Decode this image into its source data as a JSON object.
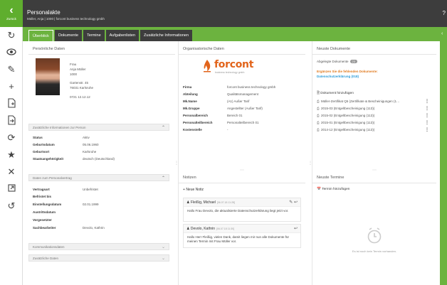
{
  "header": {
    "back_label": "Zurück",
    "title": "Personalakte",
    "subtitle": "Müller, Anja | 1000 | forcont business technology gmbh",
    "help": "?"
  },
  "tabs": [
    {
      "label": "Überblick",
      "active": true
    },
    {
      "label": "Dokumente",
      "active": false
    },
    {
      "label": "Termine",
      "active": false
    },
    {
      "label": "Aufgabenlisten",
      "active": false
    },
    {
      "label": "Zusätzliche Informationen",
      "active": false
    }
  ],
  "personal": {
    "title": "Persönliche Daten",
    "salutation": "Frau",
    "name": "Anja Müller",
    "number": "1000",
    "street": "Gartenstr. 45",
    "city": "76031 Karlsruhe",
    "phone": "0721 12.12.12"
  },
  "accordions": {
    "zusatz": "Zusätzliche Informationen zur Person",
    "vertrag": "Daten zum Personalvertrag",
    "kommunikation": "Kommunikationsdaten",
    "zusaetzliche": "Zusätzliche Daten"
  },
  "zusatz_fields": [
    {
      "k": "Status",
      "v": "Aktiv"
    },
    {
      "k": "Geburtsdatum",
      "v": "05.06.1960"
    },
    {
      "k": "Geburtsort",
      "v": "Karlsruhe"
    },
    {
      "k": "Staatsangehörigkeit",
      "v": "deutsch (Deutschland)"
    }
  ],
  "vertrag_fields": [
    {
      "k": "Vertragsart",
      "v": "Unbefristet"
    },
    {
      "k": "Befristet bis",
      "v": ""
    },
    {
      "k": "Einstellungsdatum",
      "v": "02.01.1999"
    },
    {
      "k": "Austrittsdatum",
      "v": ""
    },
    {
      "k": "Vorgesetzter",
      "v": ""
    },
    {
      "k": "Sachbearbeiter",
      "v": "Devolo, Kathrin"
    }
  ],
  "org": {
    "title": "Organisatorische Daten",
    "logo_text": "forcont",
    "logo_sub": "business technology gmbh",
    "fields": [
      {
        "k": "Firma",
        "v": "forcont business technology gmbh"
      },
      {
        "k": "Abteilung",
        "v": "Qualitätsmanagement"
      },
      {
        "k": "Mk.Name",
        "v": "(A1) Außer Tarif"
      },
      {
        "k": "Mk.Gruppe",
        "v": "Angestellter (Außer Tarif)"
      },
      {
        "k": "Personalbereich",
        "v": "Bereich 01"
      },
      {
        "k": "Personalteilbereich",
        "v": "Personalteilbereich 01"
      },
      {
        "k": "Kostenstelle",
        "v": "-"
      }
    ]
  },
  "docs": {
    "title": "Neuste Dokumente",
    "count_label": "Abgelegte Dokumente",
    "count": "23",
    "warn1": "Ergänzen Sie die fehlenden Dokumente:",
    "warn2": "Datenschutzerklärung (018)",
    "add_label": "Dokument hinzufügen",
    "items": [
      "Müller-Zertifikat Q5 (Zertifikate & Bescheinigungen (1…",
      "2015-03 (Entgeltbescheinigung (113))",
      "2015-02 (Entgeltbescheinigung (113))",
      "2015-01 (Entgeltbescheinigung (113))",
      "2014-12 (Entgeltbescheinigung (113))"
    ]
  },
  "notes": {
    "title": "Notizen",
    "add_label": "Neue Notiz",
    "items": [
      {
        "author": "Fleißig, Michael",
        "date": "[06.07.18 11:28]",
        "text": "Hallo Frau Devolo, die aktualisierte Datenschutzerklärung liegt jetzt vor."
      },
      {
        "author": "Devolo, Kathrin",
        "date": "[06.07.18 11:30]",
        "text": "Hallo Herr Fleißig, vielen Dank, damit liegen mir nun alle Dokumente für meinen Termin mit Frau Müller vor."
      }
    ]
  },
  "termine": {
    "title": "Neuste Termine",
    "add_label": "Termin hinzufügen",
    "empty": "Es ist noch kein Termin vorhanden."
  },
  "colors": {
    "accent": "#6cb33f",
    "dark": "#3d3d3d",
    "brand": "#e2641b",
    "warn": "#e07a1f",
    "link": "#2a9bd8"
  }
}
